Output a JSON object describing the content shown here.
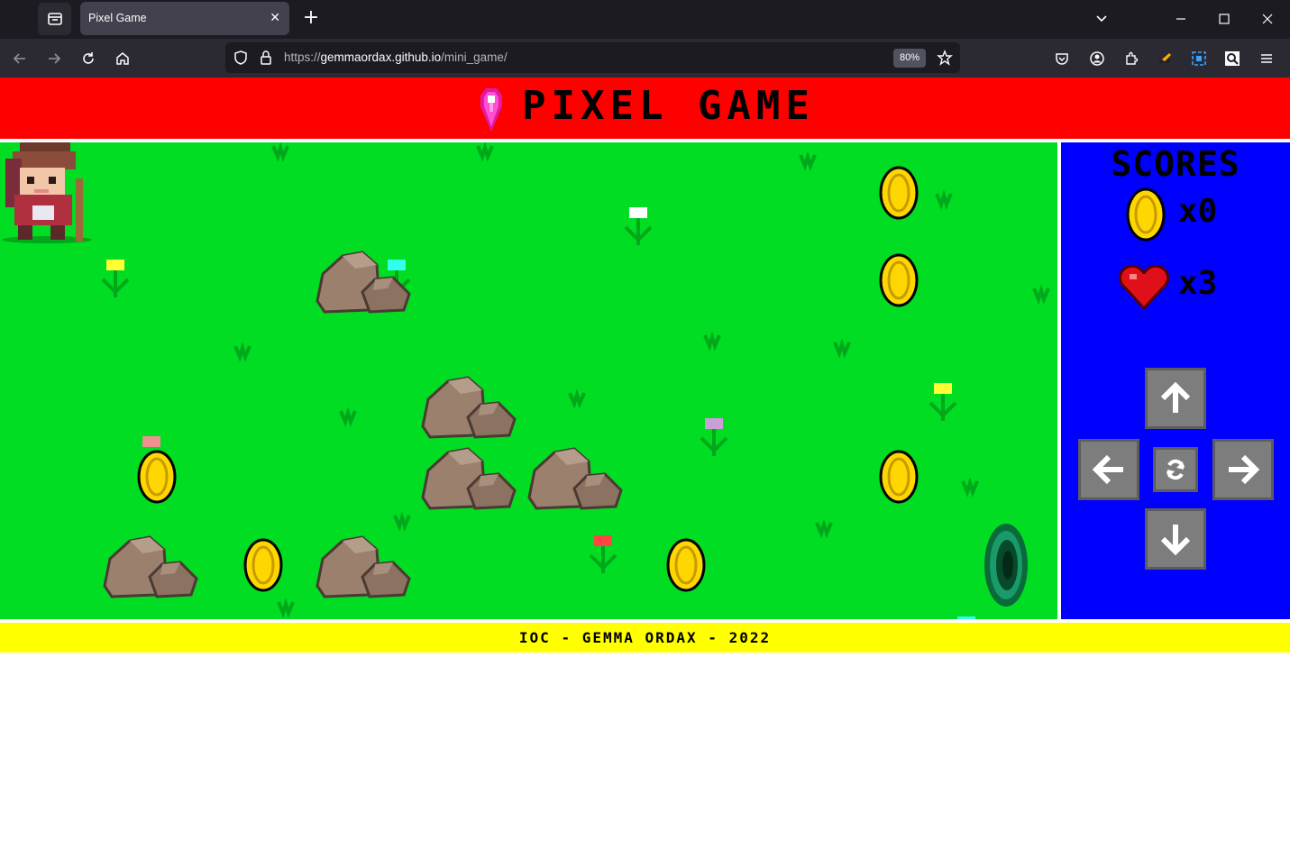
{
  "browser": {
    "tab_title": "Pixel Game",
    "url_prefix": "https://",
    "url_host": "gemmaordax.github.io",
    "url_path": "/mini_game/",
    "zoom": "80%"
  },
  "page": {
    "title": "PIXEL GAME",
    "footer": "IOC - GEMMA ORDAX - 2022"
  },
  "scores": {
    "title": "SCORES",
    "coins": "x0",
    "lives": "x3"
  },
  "controls": {
    "up": "up",
    "down": "down",
    "left": "left",
    "right": "right",
    "reset": "reset"
  },
  "colors": {
    "header": "#ff0000",
    "field": "#00dd22",
    "panel": "#0000ff",
    "footer": "#ffff00",
    "coin": "#ffd700"
  }
}
